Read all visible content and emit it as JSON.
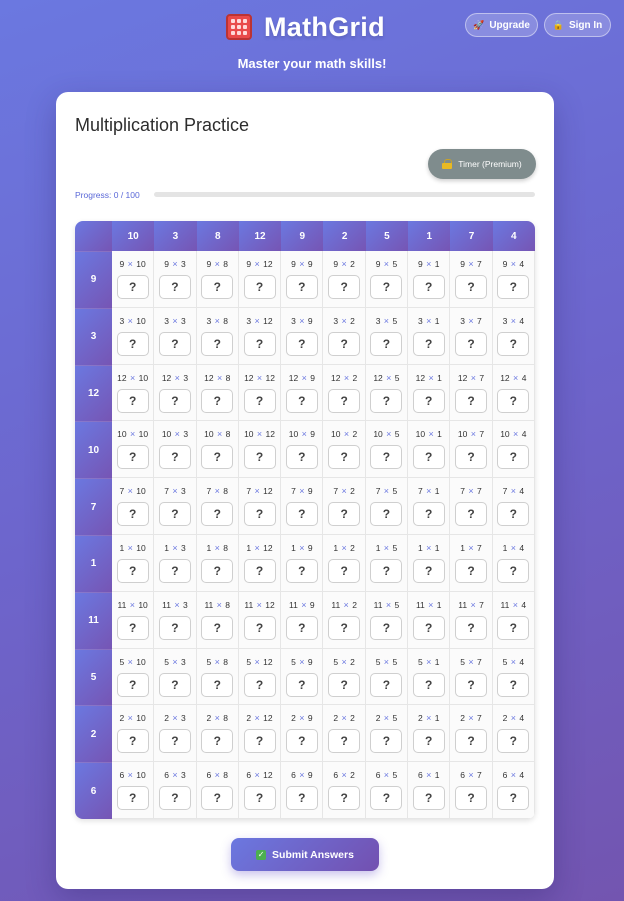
{
  "header": {
    "title": "MathGrid",
    "subtitle": "Master your math skills!",
    "upgrade_label": "Upgrade",
    "signin_label": "Sign In"
  },
  "practice": {
    "title": "Multiplication Practice",
    "timer_label": "Timer (Premium)",
    "progress_text": "Progress: 0 / 100",
    "progress_value": 0,
    "progress_total": 100,
    "answer_placeholder": "?",
    "columns": [
      10,
      3,
      8,
      12,
      9,
      2,
      5,
      1,
      7,
      4
    ],
    "rows": [
      9,
      3,
      12,
      10,
      7,
      1,
      11,
      5,
      2,
      6
    ],
    "operator": "×",
    "submit_label": "Submit Answers"
  },
  "icons": {
    "logo": "abacus-icon",
    "upgrade": "rocket-icon",
    "signin": "lock-icon",
    "timer": "lock-icon",
    "submit": "check-icon"
  },
  "colors": {
    "accent": "#6b78e0",
    "accent_dark": "#7350b0",
    "timer_gray": "#7f8c8d",
    "submit_check": "#4caf50"
  }
}
